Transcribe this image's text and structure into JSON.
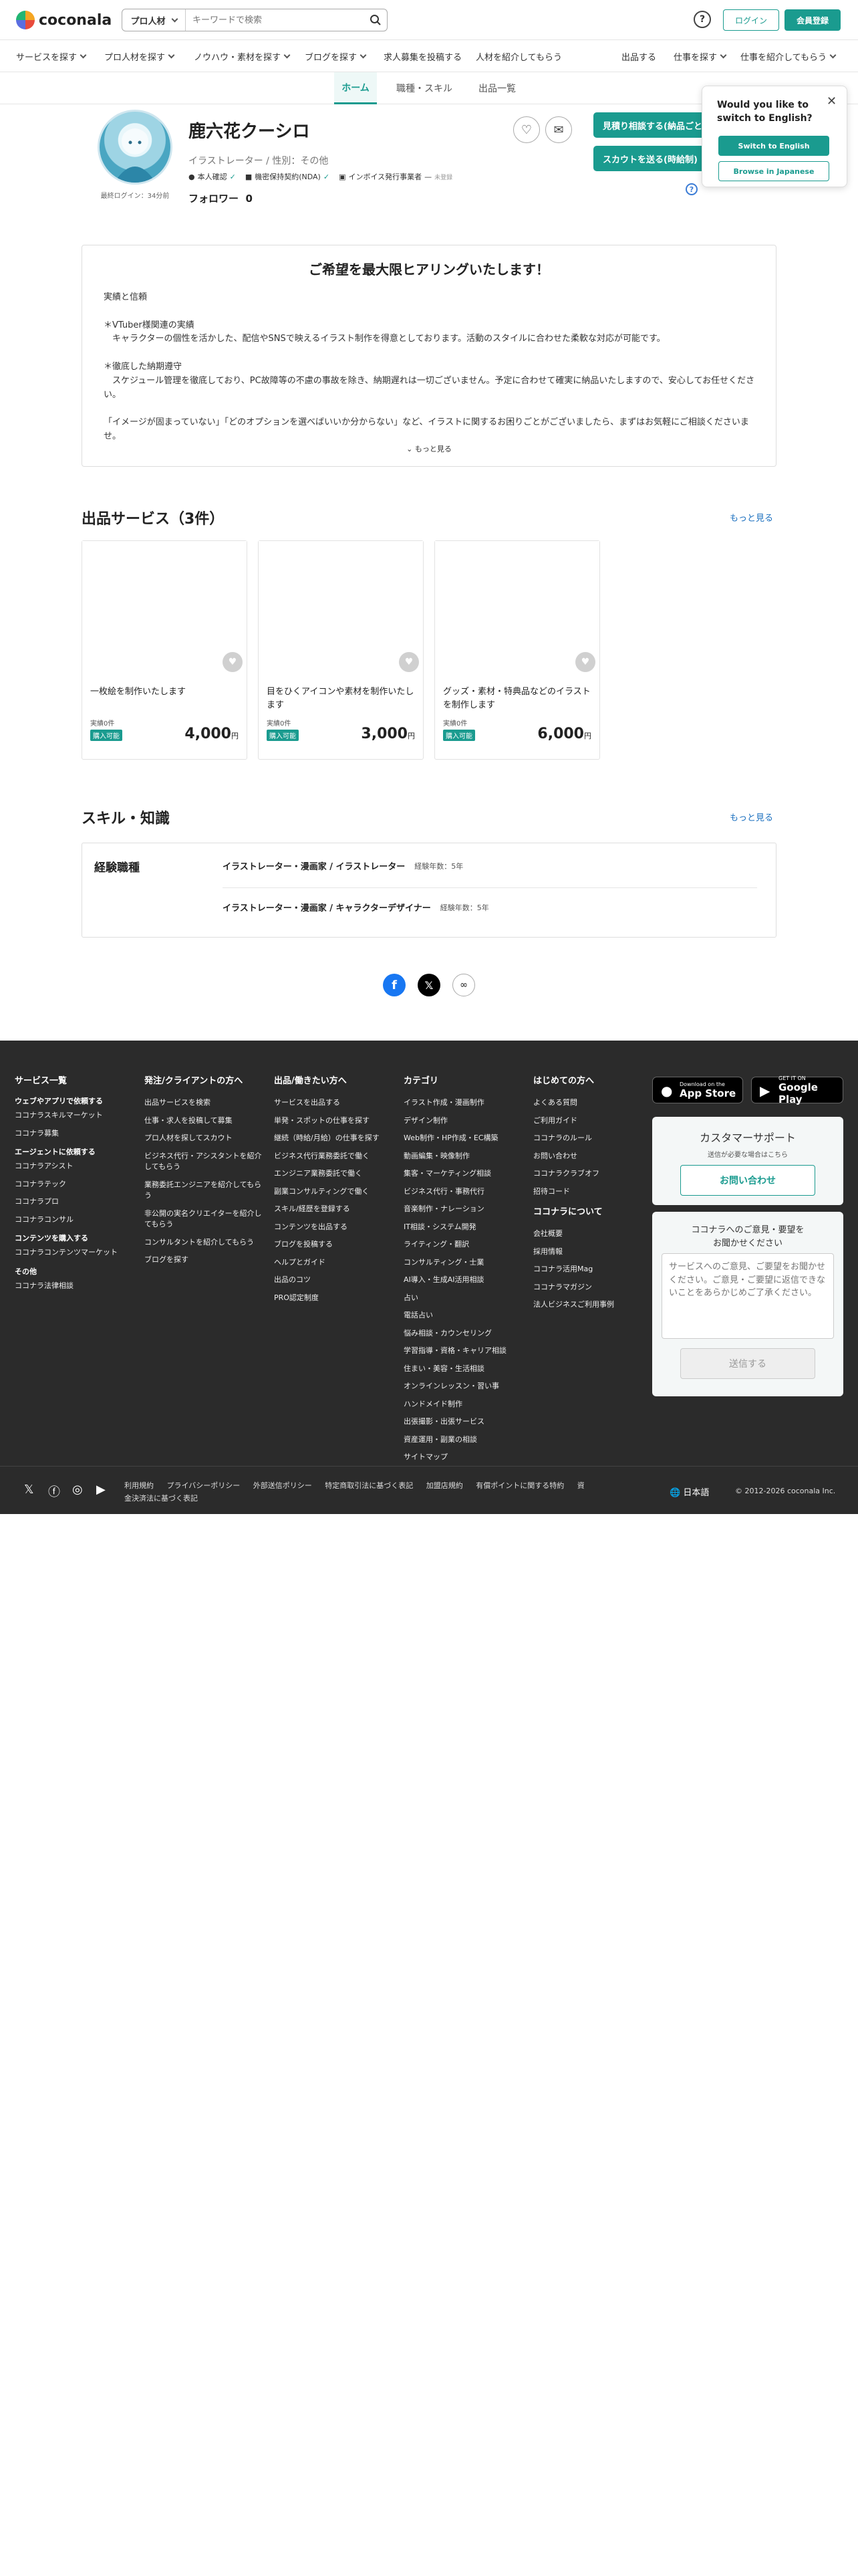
{
  "header": {
    "logo": "coconala",
    "search_category": "プロ人材",
    "search_placeholder": "キーワードで検索",
    "login": "ログイン",
    "register": "会員登録"
  },
  "nav": {
    "left": [
      "サービスを探す",
      "プロ人材を探す",
      "ノウハウ・素材を探す",
      "ブログを探す",
      "求人募集を投稿する",
      "人材を紹介してもらう"
    ],
    "right": [
      "出品する",
      "仕事を探す",
      "仕事を紹介してもらう"
    ]
  },
  "profile_tabs": [
    "ホーム",
    "職種・スキル",
    "出品一覧"
  ],
  "profile": {
    "name": "鹿六花クーシロ",
    "role": "イラストレーター / 性別：その他",
    "badge_identity": "本人確認",
    "badge_nda": "機密保持契約(NDA)",
    "badge_invoice": "インボイス発行事業者",
    "badge_invoice_note": "未登録",
    "last_login": "最終ログイン：34分前",
    "followers_label": "フォロワー",
    "followers_count": "0",
    "btn_estimate": "見積り相談する(納品ごと)",
    "btn_scout": "スカウトを送る(時給制)"
  },
  "popup": {
    "title": "Would you like to switch to English?",
    "switch": "Switch to English",
    "stay": "Browse in Japanese"
  },
  "intro": {
    "title": "ご希望を最大限ヒアリングいたします！",
    "lines": [
      "実績と信頼",
      "",
      "＊VTuber様関連の実績",
      "　キャラクターの個性を活かした、配信やSNSで映えるイラスト制作を得意としております。活動のスタイルに合わせた柔軟な対応が可能です。",
      "",
      "＊徹底した納期遵守",
      "　スケジュール管理を徹底しており、PC故障等の不慮の事故を除き、納期遅れは一切ございません。予定に合わせて確実に納品いたしますので、安心してお任せください。",
      "",
      "「イメージが固まっていない」「どのオプションを選べばいいか分からない」など、イラストに関するお困りごとがございましたら、まずはお気軽にご相談くださいませ。"
    ],
    "more": "もっと見る"
  },
  "services": {
    "title": "出品サービス（3件）",
    "more": "もっと見る",
    "items": [
      {
        "title": "一枚絵を制作いたします",
        "count": "実績0件",
        "tag": "購入可能",
        "price": "4,000",
        "unit": "円"
      },
      {
        "title": "目をひくアイコンや素材を制作いたします",
        "count": "実績0件",
        "tag": "購入可能",
        "price": "3,000",
        "unit": "円"
      },
      {
        "title": "グッズ・素材・特典品などのイラストを制作します",
        "count": "実績0件",
        "tag": "購入可能",
        "price": "6,000",
        "unit": "円"
      }
    ]
  },
  "skills": {
    "title": "スキル・知識",
    "more": "もっと見る",
    "label": "経験職種",
    "rows": [
      {
        "name": "イラストレーター・漫画家 / イラストレーター",
        "years": "経験年数：5年"
      },
      {
        "name": "イラストレーター・漫画家 / キャラクターデザイナー",
        "years": "経験年数：5年"
      }
    ]
  },
  "footer": {
    "col1": {
      "title": "サービス一覧",
      "groups": [
        {
          "sub": "ウェブやアプリで依頼する",
          "links": [
            "ココナラスキルマーケット",
            "ココナラ募集"
          ]
        },
        {
          "sub": "エージェントに依頼する",
          "links": [
            "ココナラアシスト",
            "ココナラテック",
            "ココナラプロ",
            "ココナラコンサル"
          ]
        },
        {
          "sub": "コンテンツを購入する",
          "links": [
            "ココナラコンテンツマーケット"
          ]
        },
        {
          "sub": "その他",
          "links": [
            "ココナラ法律相談"
          ]
        }
      ]
    },
    "col2": {
      "title": "発注/クライアントの方へ",
      "links": [
        "出品サービスを検索",
        "仕事・求人を投稿して募集",
        "プロ人材を探してスカウト",
        "ビジネス代行・アシスタントを紹介してもらう",
        "業務委託エンジニアを紹介してもらう",
        "非公開の実名クリエイターを紹介してもらう",
        "コンサルタントを紹介してもらう",
        "ブログを探す"
      ]
    },
    "col3": {
      "title": "出品/働きたい方へ",
      "links": [
        "サービスを出品する",
        "単発・スポットの仕事を探す",
        "継続（時給/月給）の仕事を探す",
        "ビジネス代行業務委託で働く",
        "エンジニア業務委託で働く",
        "副業コンサルティングで働く",
        "スキル/経歴を登録する",
        "コンテンツを出品する",
        "ブログを投稿する",
        "ヘルプとガイド",
        "出品のコツ",
        "PRO認定制度"
      ]
    },
    "col4": {
      "title": "カテゴリ",
      "links": [
        "イラスト作成・漫画制作",
        "デザイン制作",
        "Web制作・HP作成・EC構築",
        "動画編集・映像制作",
        "集客・マーケティング相談",
        "ビジネス代行・事務代行",
        "音楽制作・ナレーション",
        "IT相談・システム開発",
        "ライティング・翻訳",
        "コンサルティング・士業",
        "AI導入・生成AI活用相談",
        "占い",
        "電話占い",
        "悩み相談・カウンセリング",
        "学習指導・資格・キャリア相談",
        "住まい・美容・生活相談",
        "オンラインレッスン・習い事",
        "ハンドメイド制作",
        "出張撮影・出張サービス",
        "資産運用・副業の相談",
        "サイトマップ"
      ]
    },
    "col5": {
      "title": "はじめての方へ",
      "links": [
        "よくある質問",
        "ご利用ガイド",
        "ココナラのルール",
        "お問い合わせ",
        "ココナラクラブオフ",
        "招待コード"
      ],
      "title2": "ココナラについて",
      "links2": [
        "会社概要",
        "採用情報",
        "ココナラ活用Mag",
        "ココナラマガジン",
        "法人ビジネスご利用事例"
      ]
    },
    "app_store_small": "Download on the",
    "app_store": "App Store",
    "google_small": "GET IT ON",
    "google": "Google Play",
    "support_title": "カスタマーサポート",
    "support_sub": "送信が必要な場合はこちら",
    "contact": "お問い合わせ",
    "feedback_title": "ココナラへのご意見・要望を\nお聞かせください",
    "feedback_placeholder": "サービスへのご意見、ご要望をお聞かせください。ご意見・ご要望に返信できないことをあらかじめご了承ください。",
    "send": "送信する",
    "legal": [
      "利用規約",
      "プライバシーポリシー",
      "外部送信ポリシー",
      "特定商取引法に基づく表記",
      "加盟店規約",
      "有償ポイントに関する特約",
      "資金決済法に基づく表記"
    ],
    "lang": "日本語",
    "copyright": "© 2012-2026 coconala Inc."
  }
}
